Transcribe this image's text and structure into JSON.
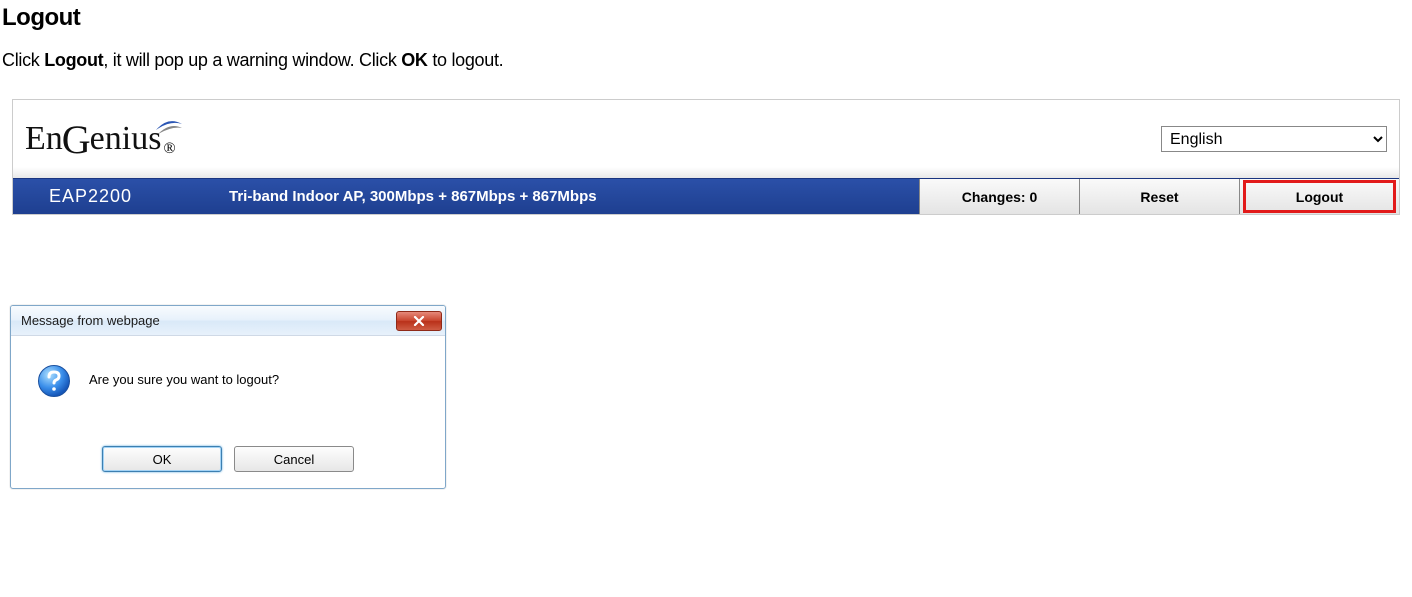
{
  "doc": {
    "heading": "Logout",
    "instruction_pre": "Click ",
    "instruction_b1": "Logout",
    "instruction_mid": ", it will pop up a warning window. Click ",
    "instruction_b2": "OK",
    "instruction_post": " to logout."
  },
  "header": {
    "brand_part1": "En",
    "brand_mid": "G",
    "brand_part2": "enius",
    "brand_reg": "®",
    "language": "English",
    "model": "EAP2200",
    "description": "Tri-band Indoor AP, 300Mbps + 867Mbps + 867Mbps",
    "changes_label": "Changes: 0",
    "reset_label": "Reset",
    "logout_label": "Logout"
  },
  "dialog": {
    "title": "Message from webpage",
    "message": "Are you sure you want to logout?",
    "ok_label": "OK",
    "cancel_label": "Cancel"
  }
}
